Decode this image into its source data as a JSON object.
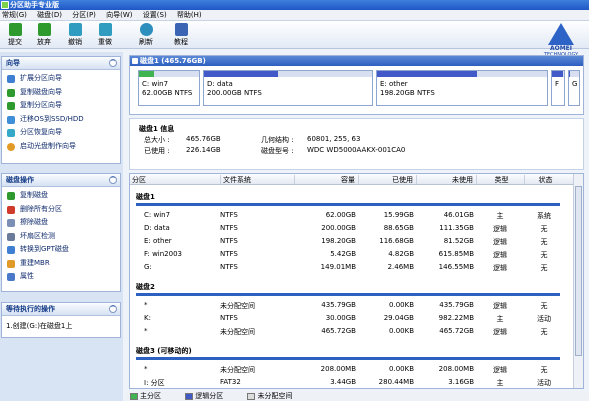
{
  "window": {
    "title": "分区助手专业版"
  },
  "menu": [
    "常规(G)",
    "磁盘(D)",
    "分区(P)",
    "向导(W)",
    "设置(S)",
    "帮助(H)"
  ],
  "toolbar": [
    {
      "label": "提交",
      "icon": "check-icon",
      "color": "#2e9a2e"
    },
    {
      "label": "放弃",
      "icon": "x-icon",
      "color": "#2e9a2e"
    },
    {
      "label": "撤销",
      "icon": "undo-icon",
      "color": "#2f9cc0"
    },
    {
      "label": "重做",
      "icon": "redo-icon",
      "color": "#2f9cc0"
    },
    {
      "label": "刷新",
      "icon": "refresh-icon",
      "color": "#2d8fbd"
    },
    {
      "label": "教程",
      "icon": "book-icon",
      "color": "#3b64b4"
    }
  ],
  "brand": {
    "line1": "AOMEI",
    "line2": "TECHNOLOGY"
  },
  "wizard": {
    "title": "向导",
    "items": [
      "扩展分区向导",
      "复制磁盘向导",
      "复制分区向导",
      "迁移OS到SSD/HDD",
      "分区恢复向导",
      "启动光盘制作向导"
    ]
  },
  "disk_ops": {
    "title": "磁盘操作",
    "items": [
      "复制磁盘",
      "删除所有分区",
      "擦除磁盘",
      "坏扇区检测",
      "转换到GPT磁盘",
      "重建MBR",
      "属性"
    ]
  },
  "pending": {
    "title": "等待执行的操作",
    "item": "1.创建(G:)在磁盘1上"
  },
  "diskmap": {
    "title": "磁盘1 (465.76GB)",
    "segments": [
      {
        "name": "C: win7",
        "size": "62.00GB NTFS",
        "color": "#3fb34f",
        "fill": 0.25
      },
      {
        "name": "D: data",
        "size": "200.00GB NTFS",
        "color": "#4259c8",
        "fill": 0.44
      },
      {
        "name": "E: other",
        "size": "198.20GB NTFS",
        "color": "#4259c8",
        "fill": 0.59
      },
      {
        "name": "F",
        "size": "",
        "color": "#4259c8",
        "fill": 0.9
      },
      {
        "name": "G",
        "size": "",
        "color": "#4259c8",
        "fill": 0.1
      }
    ]
  },
  "info": {
    "heading": "磁盘1 信息",
    "total_label": "总大小 :",
    "total": "465.76GB",
    "used_label": "已使用 :",
    "used": "226.14GB",
    "geometry_label": "几何结构 :",
    "geometry": "60801, 255, 63",
    "model_label": "磁盘型号 :",
    "model": "WDC WD5000AAKX-001CA0"
  },
  "columns": [
    "分区",
    "文件系统",
    "容量",
    "已使用",
    "未使用",
    "类型",
    "状态"
  ],
  "disks": [
    {
      "title": "磁盘1",
      "rows": [
        [
          "C: win7",
          "NTFS",
          "62.00GB",
          "15.99GB",
          "46.01GB",
          "主",
          "系统"
        ],
        [
          "D: data",
          "NTFS",
          "200.00GB",
          "88.65GB",
          "111.35GB",
          "逻辑",
          "无"
        ],
        [
          "E: other",
          "NTFS",
          "198.20GB",
          "116.68GB",
          "81.52GB",
          "逻辑",
          "无"
        ],
        [
          "F: win2003",
          "NTFS",
          "5.42GB",
          "4.82GB",
          "615.85MB",
          "逻辑",
          "无"
        ],
        [
          "G:",
          "NTFS",
          "149.01MB",
          "2.46MB",
          "146.55MB",
          "逻辑",
          "无"
        ]
      ]
    },
    {
      "title": "磁盘2",
      "rows": [
        [
          "*",
          "未分配空间",
          "435.79GB",
          "0.00KB",
          "435.79GB",
          "逻辑",
          "无"
        ],
        [
          "K:",
          "NTFS",
          "30.00GB",
          "29.04GB",
          "982.22MB",
          "主",
          "活动"
        ],
        [
          "*",
          "未分配空间",
          "465.72GB",
          "0.00KB",
          "465.72GB",
          "逻辑",
          "无"
        ]
      ]
    },
    {
      "title": "磁盘3 (可移动的)",
      "rows": [
        [
          "*",
          "未分配空间",
          "208.00MB",
          "0.00KB",
          "208.00MB",
          "逻辑",
          "无"
        ],
        [
          "I: 分区",
          "FAT32",
          "3.44GB",
          "280.44MB",
          "3.16GB",
          "主",
          "活动"
        ]
      ]
    }
  ],
  "legend": [
    {
      "label": "主分区",
      "color": "#3fb34f"
    },
    {
      "label": "逻辑分区",
      "color": "#4259c8"
    },
    {
      "label": "未分配空间",
      "color": "#dcdcdc"
    }
  ]
}
